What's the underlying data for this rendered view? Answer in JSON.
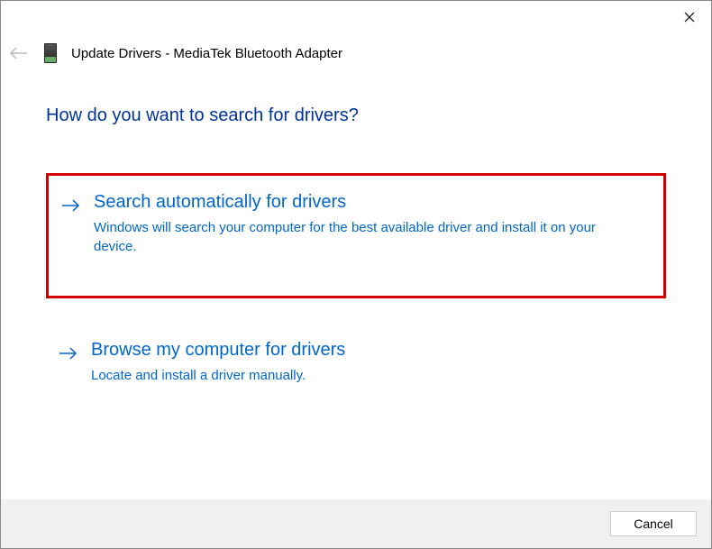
{
  "window": {
    "title": "Update Drivers - MediaTek Bluetooth Adapter"
  },
  "heading": "How do you want to search for drivers?",
  "options": [
    {
      "title": "Search automatically for drivers",
      "description": "Windows will search your computer for the best available driver and install it on your device."
    },
    {
      "title": "Browse my computer for drivers",
      "description": "Locate and install a driver manually."
    }
  ],
  "buttons": {
    "cancel": "Cancel"
  }
}
